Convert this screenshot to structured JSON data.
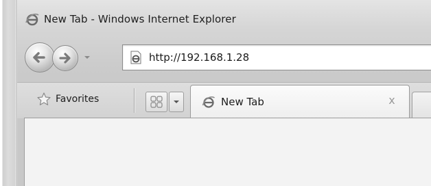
{
  "window": {
    "title": "New Tab - Windows Internet Explorer"
  },
  "navigation": {
    "back_icon": "back-arrow-icon",
    "forward_icon": "forward-arrow-icon",
    "address": "http://192.168.1.28"
  },
  "command_bar": {
    "favorites_label": "Favorites",
    "favorites_icon": "star-icon"
  },
  "tabs": [
    {
      "label": "New Tab",
      "close_glyph": "x",
      "icon": "ie-logo-icon"
    }
  ],
  "colors": {
    "chrome": "#d6d6d6",
    "content": "#f3f3f3"
  }
}
